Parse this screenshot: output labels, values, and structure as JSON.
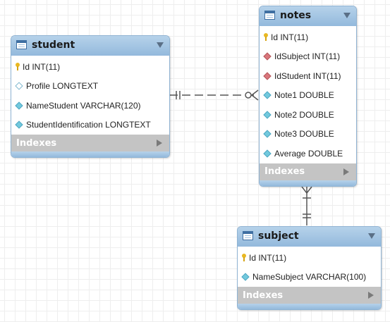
{
  "entities": {
    "student": {
      "title": "student",
      "columns": [
        {
          "text": "Id INT(11)",
          "kind": "key-icon"
        },
        {
          "text": "Profile LONGTEXT",
          "kind": "nullable-column-icon"
        },
        {
          "text": "NameStudent VARCHAR(120)",
          "kind": "column-icon"
        },
        {
          "text": "StudentIdentification LONGTEXT",
          "kind": "column-icon"
        }
      ],
      "indexes_label": "Indexes"
    },
    "notes": {
      "title": "notes",
      "columns": [
        {
          "text": "Id INT(11)",
          "kind": "key-icon"
        },
        {
          "text": "IdSubject INT(11)",
          "kind": "foreign-key-icon"
        },
        {
          "text": "IdStudent INT(11)",
          "kind": "foreign-key-icon"
        },
        {
          "text": "Note1 DOUBLE",
          "kind": "column-icon"
        },
        {
          "text": "Note2 DOUBLE",
          "kind": "column-icon"
        },
        {
          "text": "Note3 DOUBLE",
          "kind": "column-icon"
        },
        {
          "text": "Average DOUBLE",
          "kind": "column-icon"
        }
      ],
      "indexes_label": "Indexes"
    },
    "subject": {
      "title": "subject",
      "columns": [
        {
          "text": "Id INT(11)",
          "kind": "key-icon"
        },
        {
          "text": "NameSubject VARCHAR(100)",
          "kind": "column-icon"
        }
      ],
      "indexes_label": "Indexes"
    }
  },
  "relationships": [
    {
      "from": "student",
      "to": "notes",
      "style": "dashed",
      "from_end": "one-and-only-one",
      "to_end": "zero-or-many"
    },
    {
      "from": "subject",
      "to": "notes",
      "style": "solid",
      "from_end": "one-and-only-one",
      "to_end": "one-or-many"
    }
  ],
  "colors": {
    "header": "#a7c7e4",
    "indexes_bar": "#c4c4c4",
    "key": "#e9b821",
    "foreign_key": "#d9777c",
    "column": "#72c9dd",
    "connector": "#555555"
  }
}
